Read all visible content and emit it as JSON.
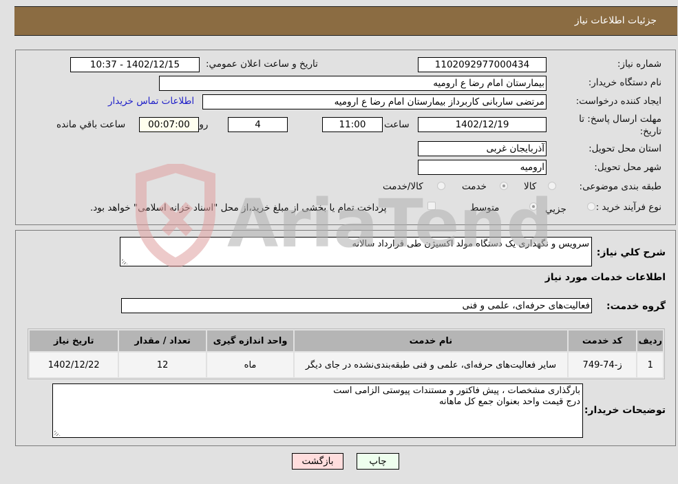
{
  "header": {
    "title": "جزئیات اطلاعات نیاز"
  },
  "form": {
    "need_number": {
      "label": "شماره نیاز:",
      "value": "1102092977000434"
    },
    "announce_datetime": {
      "label": "تاریخ و ساعت اعلان عمومي:",
      "value": "1402/12/15 - 10:37"
    },
    "buyer_org": {
      "label": "نام دستگاه خریدار:",
      "value": "بیمارستان امام رضا  ع  ارومیه"
    },
    "creator": {
      "label": "ایجاد کننده درخواست:",
      "value": "مرتضی ساربانی کاربرداز بیمارستان امام رضا  ع  ارومیه"
    },
    "contact_link": "اطلاعات تماس خریدار",
    "deadline": {
      "label_line1": "مهلت ارسال پاسخ: تا",
      "label_line2": "تاریخ:",
      "date": "1402/12/19",
      "time_label": "ساعت",
      "time": "11:00",
      "days": "4",
      "days_label": "روز و",
      "remaining": "00:07:00",
      "remaining_label": "ساعت باقي مانده"
    },
    "province": {
      "label": "استان محل تحویل:",
      "value": "آذربایجان غربی"
    },
    "city": {
      "label": "شهر محل تحویل:",
      "value": "ارومیه"
    },
    "category": {
      "label": "طبقه بندی موضوعی:",
      "options": [
        "کالا",
        "خدمت",
        "کالا/خدمت"
      ],
      "selected": "خدمت"
    },
    "purchase_process": {
      "label": "نوع فرآیند خرید :",
      "options": [
        "جزيي",
        "متوسط"
      ],
      "selected": "متوسط",
      "treasury_note": "پرداخت تمام یا بخشی از مبلغ خرید،از محل \"اسناد خزانه اسلامی\" خواهد بود."
    }
  },
  "details": {
    "general_desc_label": "شرح کلي نیاز:",
    "general_desc": "سرویس و نگهداری یک دستگاه مولد اکسیژن طی قرارداد سالانه",
    "services_title": "اطلاعات خدمات مورد نیاز",
    "service_group_label": "گروه خدمت:",
    "service_group": "فعالیت‌های حرفه‌ای، علمی و فنی",
    "table": {
      "headers": [
        "ردیف",
        "کد خدمت",
        "نام خدمت",
        "واحد اندازه گیری",
        "تعداد / مقدار",
        "تاریخ نیاز"
      ],
      "rows": [
        [
          "1",
          "ز-74-749",
          "سایر فعالیت‌های حرفه‌ای، علمی و فنی طبقه‌بندی‌نشده در جای دیگر",
          "ماه",
          "12",
          "1402/12/22"
        ]
      ]
    },
    "buyer_notes_label": "توضیحات خریدار:",
    "buyer_notes_line1": "بارگذاری مشخصات ، پیش فاکتور و مستندات پیوستی الزامی است",
    "buyer_notes_line2": "درج قیمت واحد بعنوان جمع کل ماهانه"
  },
  "buttons": {
    "print": "چاپ",
    "back": "بازگشت"
  },
  "watermark": {
    "text": "AriaTender.neT"
  }
}
